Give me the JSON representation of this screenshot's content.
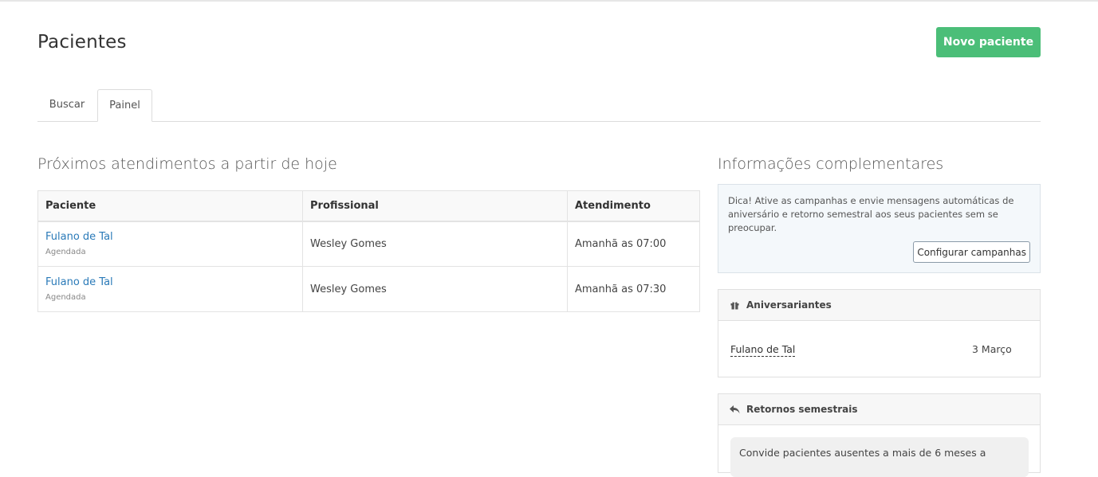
{
  "page": {
    "title": "Pacientes",
    "new_button": "Novo paciente"
  },
  "tabs": [
    {
      "label": "Buscar"
    },
    {
      "label": "Painel"
    }
  ],
  "appointments": {
    "title": "Próximos atendimentos a partir de hoje",
    "columns": [
      "Paciente",
      "Profissional",
      "Atendimento"
    ],
    "rows": [
      {
        "patient": "Fulano de Tal",
        "status": "Agendada",
        "professional": "Wesley Gomes",
        "time": "Amanhã as 07:00"
      },
      {
        "patient": "Fulano de Tal",
        "status": "Agendada",
        "professional": "Wesley Gomes",
        "time": "Amanhã as 07:30"
      }
    ]
  },
  "info": {
    "title": "Informações complementares",
    "tip": "Dica! Ative as campanhas e envie mensagens automáticas de aniversário e retorno semestral aos seus pacientes sem se preocupar.",
    "config_button": "Configurar campanhas"
  },
  "birthdays": {
    "title": "Aniversariantes",
    "icon": "gift-icon",
    "items": [
      {
        "name": "Fulano de Tal",
        "date": "3 Março"
      }
    ]
  },
  "returns": {
    "title": "Retornos semestrais",
    "icon": "reply-icon",
    "message": "Convide pacientes ausentes a mais de 6 meses a"
  },
  "colors": {
    "accent": "#4bbe78",
    "link": "#2a7ab8"
  }
}
